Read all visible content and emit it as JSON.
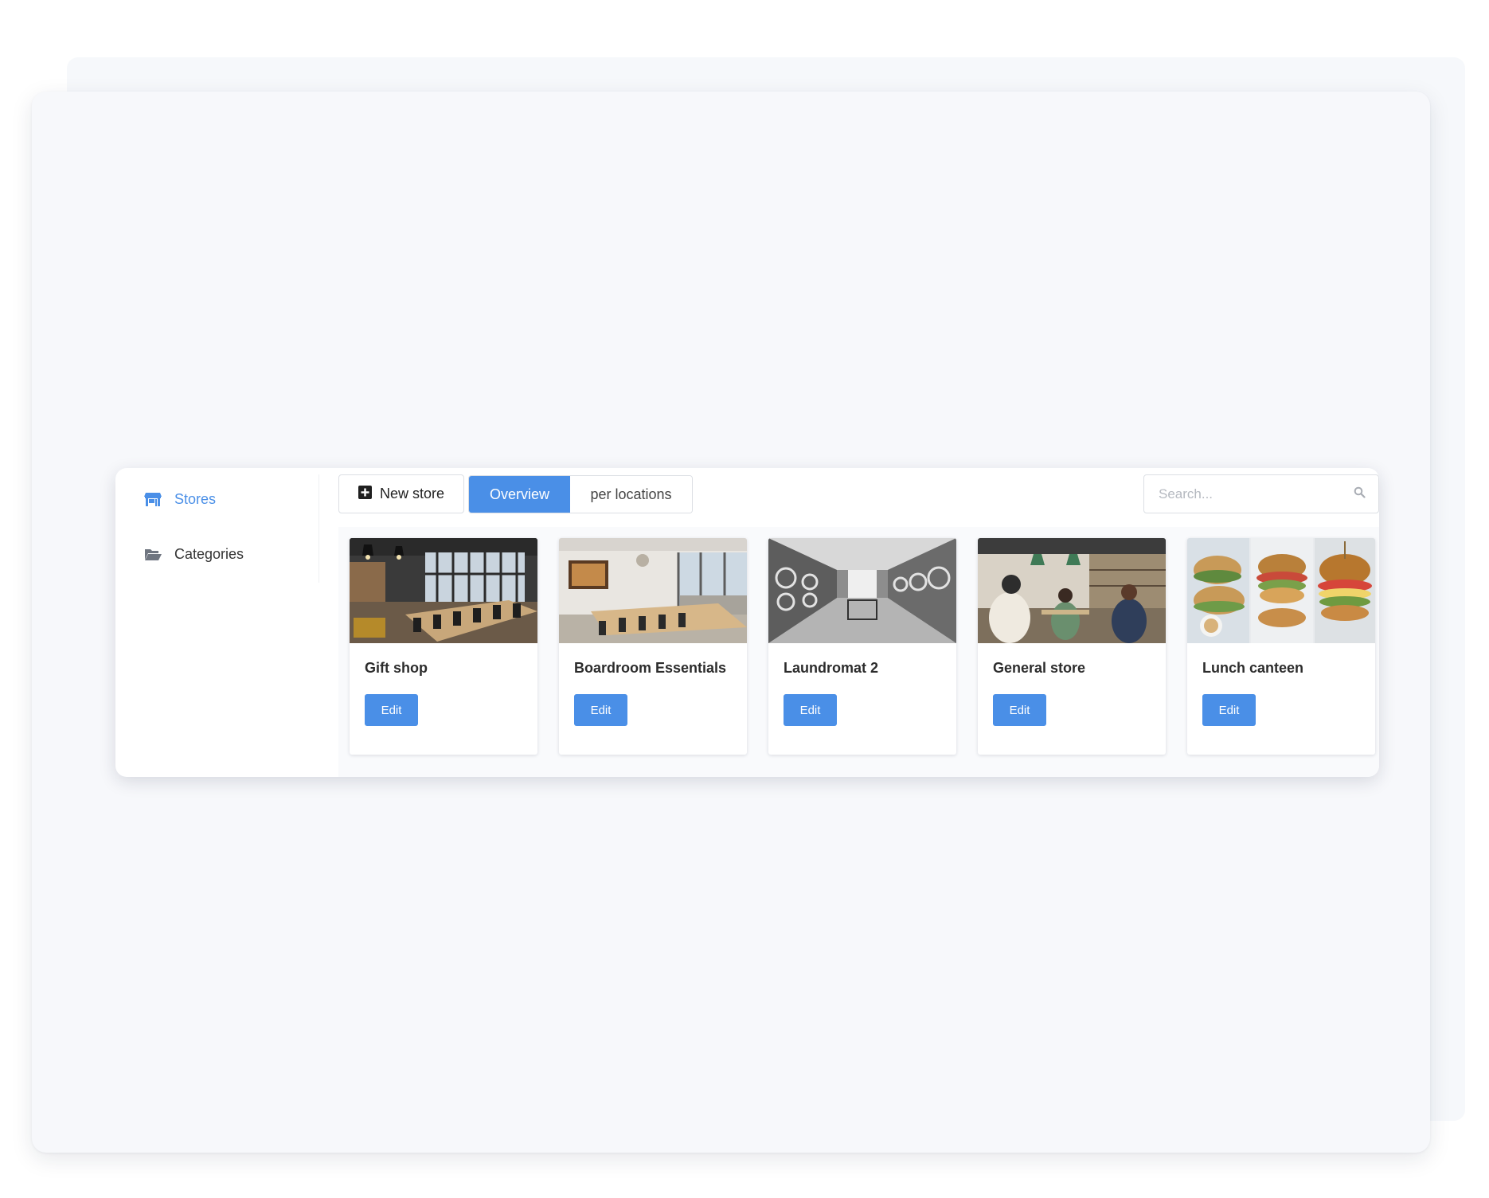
{
  "sidebar": {
    "items": [
      {
        "label": "Stores",
        "icon": "store-icon",
        "active": true
      },
      {
        "label": "Categories",
        "icon": "folder-open-icon",
        "active": false
      }
    ]
  },
  "toolbar": {
    "new_store_label": "New store",
    "tabs": [
      {
        "label": "Overview",
        "active": true
      },
      {
        "label": "per locations",
        "active": false
      }
    ],
    "search": {
      "placeholder": "Search...",
      "value": ""
    }
  },
  "stores": [
    {
      "title": "Gift shop",
      "edit_label": "Edit",
      "image": "office-photo"
    },
    {
      "title": "Boardroom Essentials",
      "edit_label": "Edit",
      "image": "boardroom-photo"
    },
    {
      "title": "Laundromat 2",
      "edit_label": "Edit",
      "image": "laundromat-photo"
    },
    {
      "title": "General store",
      "edit_label": "Edit",
      "image": "cafe-photo"
    },
    {
      "title": "Lunch canteen",
      "edit_label": "Edit",
      "image": "sandwich-photo"
    }
  ],
  "colors": {
    "accent": "#4a8fe7",
    "background": "#f7f8fb"
  }
}
